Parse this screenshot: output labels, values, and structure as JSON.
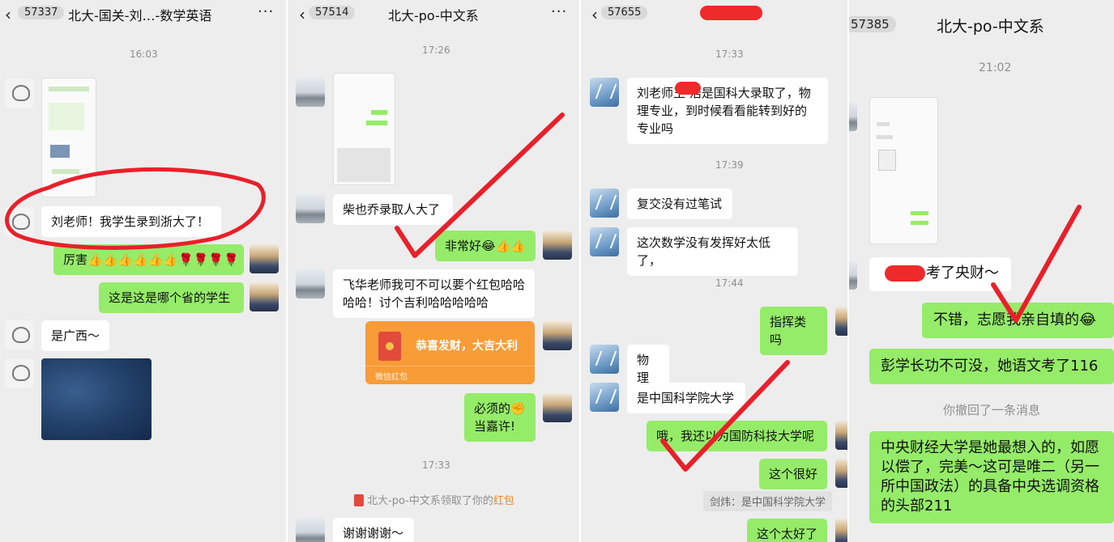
{
  "panel1": {
    "header": {
      "back_count": "57337",
      "title": "北大-国关-刘…-数学英语"
    },
    "time1": "16:03",
    "msg_received_1": "刘老师！我学生录到浙大了！",
    "msg_sent_1": "厉害👍👍👍👍👍👍🌹🌹🌹🌹",
    "msg_sent_2": "这是这是哪个省的学生",
    "msg_received_2": "是广西～"
  },
  "panel2": {
    "header": {
      "back_count": "57514",
      "title": "北大-po-中文系"
    },
    "time1": "17:26",
    "msg_received_1": "柴也乔录取人大了",
    "msg_sent_1": "非常好😂👍👍",
    "msg_received_2": "飞华老师我可不可以要个红包哈哈哈哈！讨个吉利哈哈哈哈哈",
    "red_packet": {
      "label": "恭喜发财，大吉大利",
      "footer": "微信红包"
    },
    "msg_sent_2": "必须的✊\n当嘉许!",
    "time2": "17:33",
    "system_notice_prefix": "北大-po-中文系领取了你的",
    "system_notice_link": "红包",
    "msg_received_3": "谢谢谢谢～"
  },
  "panel3": {
    "header": {
      "back_count": "57655"
    },
    "time1": "17:33",
    "msg_received_1": "刘老师王  浩是国科大录取了，物理专业，到时候看看能转到好的专业吗",
    "time2": "17:39",
    "msg_received_2": "复交没有过笔试",
    "msg_received_3": "这次数学没有发挥好太低了，",
    "time3": "17:44",
    "msg_sent_1": "指挥类吗",
    "msg_received_4": "物理",
    "msg_received_5": "是中国科学院大学",
    "msg_sent_2": "哦，我还以为国防科技大学呢",
    "msg_sent_3": "这个很好",
    "quote": "剑炜：是中国科学院大学",
    "msg_sent_4": "这个太好了"
  },
  "panel4": {
    "header": {
      "back_count": "57385",
      "title": "北大-po-中文系"
    },
    "time1": "21:02",
    "msg_received_1": "考了央财～",
    "msg_sent_1": "不错，志愿我亲自填的😂",
    "msg_sent_2": "彭学长功不可没，她语文考了116",
    "recall_notice": "你撤回了一条消息",
    "msg_sent_3": "中央财经大学是她最想入的，如愿以偿了，完美～这可是唯二（另一所中国政法）的具备中央选调资格的头部211"
  },
  "colors": {
    "sent_bubble": "#95ec69",
    "received_bubble": "#ffffff",
    "chat_bg": "#ededed",
    "ink": "#e8202a",
    "red_packet": "#f79c37"
  }
}
